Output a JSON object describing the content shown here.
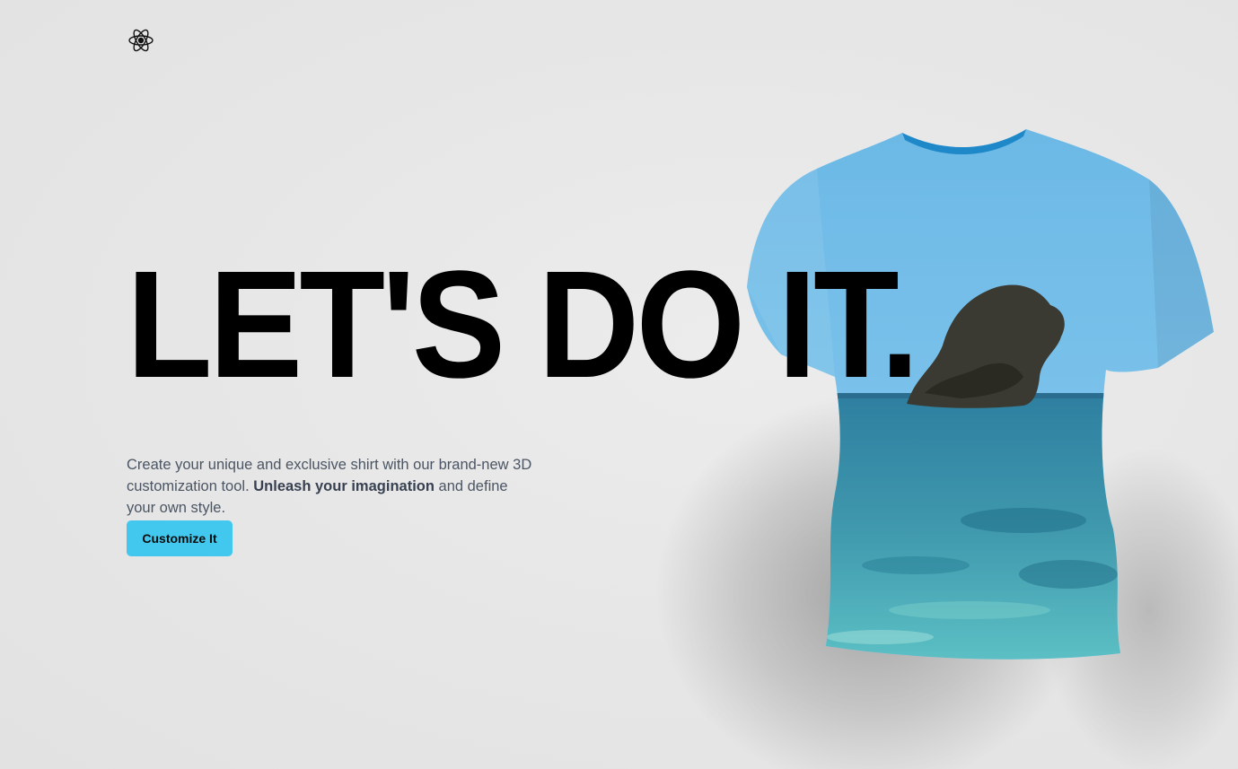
{
  "header": {
    "logo_icon": "atom-logo-icon"
  },
  "hero": {
    "title": "LET'S DO IT."
  },
  "description": {
    "part1": "Create your unique and exclusive shirt with our brand-new 3D customization tool. ",
    "emphasis": "Unleash your imagination",
    "part2": " and define your own style."
  },
  "cta": {
    "label": "Customize It",
    "color": "#42c8ee"
  },
  "shirt_preview": {
    "icon": "tshirt-3d-preview"
  }
}
